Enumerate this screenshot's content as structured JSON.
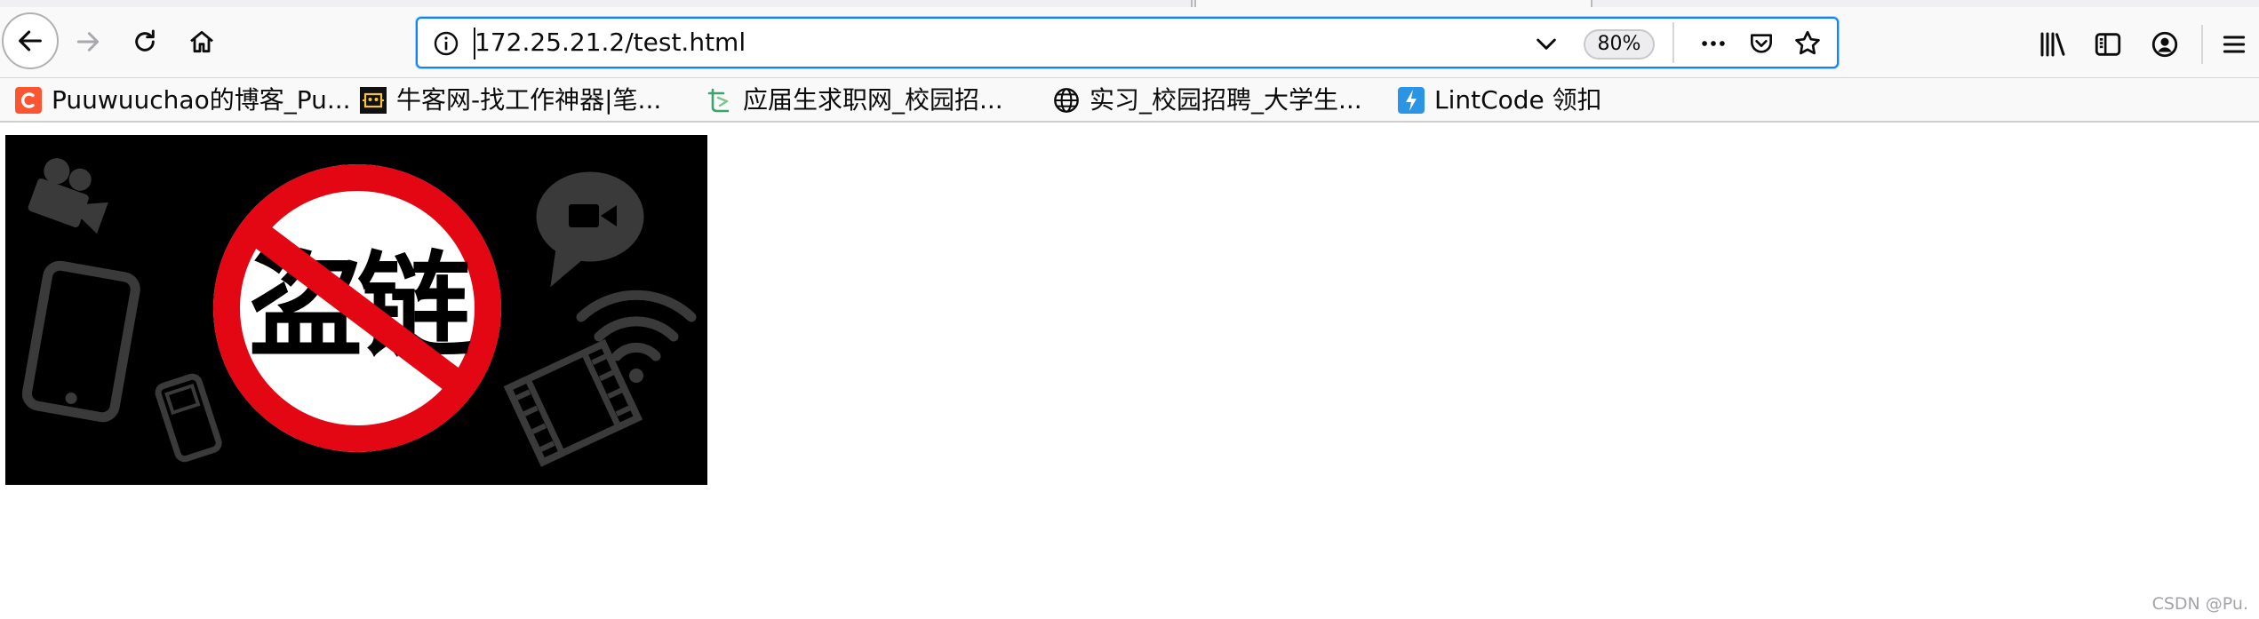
{
  "browser": {
    "url": "172.25.21.2/test.html",
    "zoom_level": "80%",
    "accent_color": "#0a84ff"
  },
  "toolbar": {
    "icons": [
      "back-icon",
      "forward-icon",
      "reload-icon",
      "home-icon",
      "page-info-icon",
      "url-dropdown-icon",
      "page-actions-icon",
      "pocket-icon",
      "bookmark-star-icon",
      "library-icon",
      "sidebar-icon",
      "account-icon",
      "menu-icon"
    ]
  },
  "bookmarks": [
    {
      "label": "Puuwuuchao的博客_Pu...",
      "icon": "csdn-icon"
    },
    {
      "label": "牛客网-找工作神器|笔...",
      "icon": "nowcoder-icon"
    },
    {
      "label": "应届生求职网_校园招...",
      "icon": "yingjiesheng-icon"
    },
    {
      "label": "实习_校园招聘_大学生...",
      "icon": "globe-icon"
    },
    {
      "label": "LintCode 领扣",
      "icon": "lintcode-icon"
    }
  ],
  "content": {
    "image_text": "盗链",
    "image_icon": "no-hotlinking-sign"
  },
  "watermark": "CSDN @Pu."
}
